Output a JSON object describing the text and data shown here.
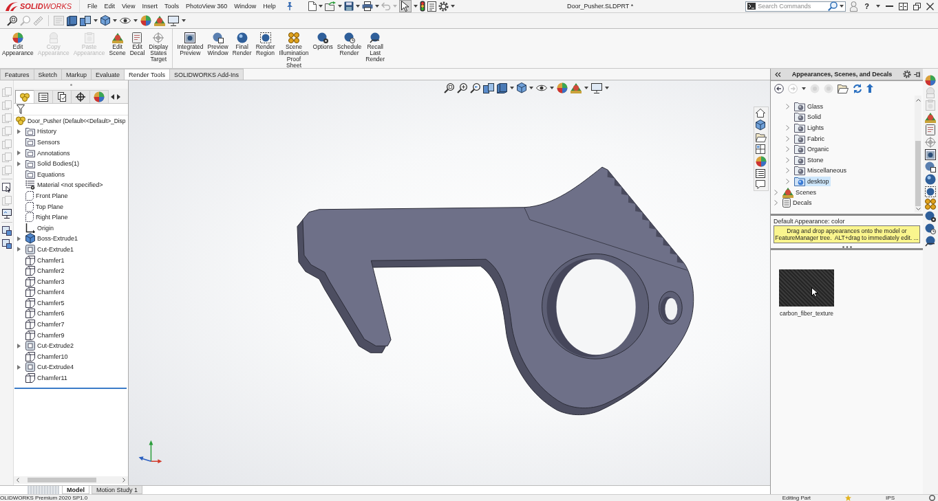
{
  "app": {
    "logo": "**SOLID**WORKS"
  },
  "menu": [
    "File",
    "Edit",
    "View",
    "Insert",
    "Tools",
    "PhotoView 360",
    "Window",
    "Help"
  ],
  "quick_access": {
    "undo_disabled": true,
    "select_on": true
  },
  "document_title": "Door_Pusher.SLDPRT *",
  "search": {
    "placeholder": "Search Commands"
  },
  "help": "?",
  "ribbon": {
    "groups": [
      {
        "commands": [
          {
            "label": "Edit Appearance",
            "disabled": false
          },
          {
            "label": "Copy Appearance",
            "disabled": true
          },
          {
            "label": "Paste Appearance",
            "disabled": true
          },
          {
            "label": "Edit Scene",
            "disabled": false
          },
          {
            "label": "Edit Decal",
            "disabled": false
          },
          {
            "label": "Display States Target",
            "disabled": false
          }
        ]
      },
      {
        "commands": [
          {
            "label": "Integrated Preview",
            "disabled": false
          },
          {
            "label": "Preview Window",
            "disabled": false
          },
          {
            "label": "Final Render",
            "disabled": false
          },
          {
            "label": "Render Region",
            "disabled": false
          },
          {
            "label": "Scene Illumination Proof Sheet",
            "disabled": false
          },
          {
            "label": "Options",
            "disabled": false
          },
          {
            "label": "Schedule Render",
            "disabled": false
          },
          {
            "label": "Recall Last Render",
            "disabled": false
          }
        ]
      }
    ]
  },
  "command_tabs": [
    {
      "label": "Features",
      "selected": false
    },
    {
      "label": "Sketch",
      "selected": false
    },
    {
      "label": "Markup",
      "selected": false
    },
    {
      "label": "Evaluate",
      "selected": false
    },
    {
      "label": "Render Tools",
      "selected": true
    },
    {
      "label": "SOLIDWORKS Add-Ins",
      "selected": false
    }
  ],
  "feature_tree": {
    "panel_tabs": [
      {
        "selected": true
      },
      {
        "selected": false
      },
      {
        "selected": false
      },
      {
        "selected": false
      },
      {
        "selected": false
      }
    ],
    "root": "Door_Pusher (Default<<Default>_Disp",
    "items": [
      {
        "label": "History",
        "kind": "folder",
        "expandable": true,
        "selected": false
      },
      {
        "label": "Sensors",
        "kind": "folder",
        "expandable": false,
        "selected": false
      },
      {
        "label": "Annotations",
        "kind": "folder",
        "expandable": true,
        "selected": false
      },
      {
        "label": "Solid Bodies(1)",
        "kind": "folder",
        "expandable": true,
        "selected": false
      },
      {
        "label": "Equations",
        "kind": "folder",
        "expandable": false,
        "selected": false
      },
      {
        "label": "Material <not specified>",
        "kind": "material",
        "expandable": false,
        "selected": false
      },
      {
        "label": "Front Plane",
        "kind": "plane",
        "expandable": false,
        "selected": false
      },
      {
        "label": "Top Plane",
        "kind": "plane",
        "expandable": false,
        "selected": false
      },
      {
        "label": "Right Plane",
        "kind": "plane",
        "expandable": false,
        "selected": false
      },
      {
        "label": "Origin",
        "kind": "origin",
        "expandable": false,
        "selected": false
      },
      {
        "label": "Boss-Extrude1",
        "kind": "boss",
        "expandable": true,
        "selected": false
      },
      {
        "label": "Cut-Extrude1",
        "kind": "cut",
        "expandable": true,
        "selected": false
      },
      {
        "label": "Chamfer1",
        "kind": "chamfer",
        "expandable": false,
        "selected": false
      },
      {
        "label": "Chamfer2",
        "kind": "chamfer",
        "expandable": false,
        "selected": false
      },
      {
        "label": "Chamfer3",
        "kind": "chamfer",
        "expandable": false,
        "selected": false
      },
      {
        "label": "Chamfer4",
        "kind": "chamfer",
        "expandable": false,
        "selected": false
      },
      {
        "label": "Chamfer5",
        "kind": "chamfer",
        "expandable": false,
        "selected": false
      },
      {
        "label": "Chamfer6",
        "kind": "chamfer",
        "expandable": false,
        "selected": false
      },
      {
        "label": "Chamfer7",
        "kind": "chamfer",
        "expandable": false,
        "selected": false
      },
      {
        "label": "Chamfer9",
        "kind": "chamfer",
        "expandable": false,
        "selected": false
      },
      {
        "label": "Cut-Extrude2",
        "kind": "cut",
        "expandable": true,
        "selected": false
      },
      {
        "label": "Chamfer10",
        "kind": "chamfer",
        "expandable": false,
        "selected": false
      },
      {
        "label": "Cut-Extrude4",
        "kind": "cut",
        "expandable": true,
        "selected": false
      },
      {
        "label": "Chamfer11",
        "kind": "chamfer",
        "expandable": false,
        "selected": false
      }
    ]
  },
  "task_pane": {
    "title": "Appearances, Scenes, and Decals",
    "appearance_folders": [
      {
        "label": "Glass",
        "kind": "folder",
        "expandable": true,
        "selected": false
      },
      {
        "label": "Solid",
        "kind": "folder",
        "expandable": false,
        "selected": false
      },
      {
        "label": "Lights",
        "kind": "folder",
        "expandable": true,
        "selected": false
      },
      {
        "label": "Fabric",
        "kind": "folder",
        "expandable": true,
        "selected": false
      },
      {
        "label": "Organic",
        "kind": "folder",
        "expandable": true,
        "selected": false
      },
      {
        "label": "Stone",
        "kind": "folder",
        "expandable": true,
        "selected": false
      },
      {
        "label": "Miscellaneous",
        "kind": "folder",
        "expandable": true,
        "selected": false
      },
      {
        "label": "desktop",
        "kind": "custom",
        "expandable": true,
        "selected": true
      }
    ],
    "root_items": [
      {
        "label": "Scenes",
        "kind": "scenes",
        "expandable": true,
        "selected": false
      },
      {
        "label": "Decals",
        "kind": "decals",
        "expandable": true,
        "selected": false
      }
    ],
    "caption": "Default Appearance: color",
    "hint": "Drag and drop appearances onto the model or FeatureManager tree.  ALT+drag to immediately edit. ...",
    "swatches": [
      {
        "label": "carbon_fiber_texture"
      }
    ]
  },
  "bottom_tabs": [
    {
      "label": "Model",
      "selected": true
    },
    {
      "label": "Motion Study 1",
      "selected": false
    }
  ],
  "status_bar": {
    "product": "OLIDWORKS Premium 2020 SP1.0",
    "mode": "Editing Part",
    "units": "IPS"
  }
}
